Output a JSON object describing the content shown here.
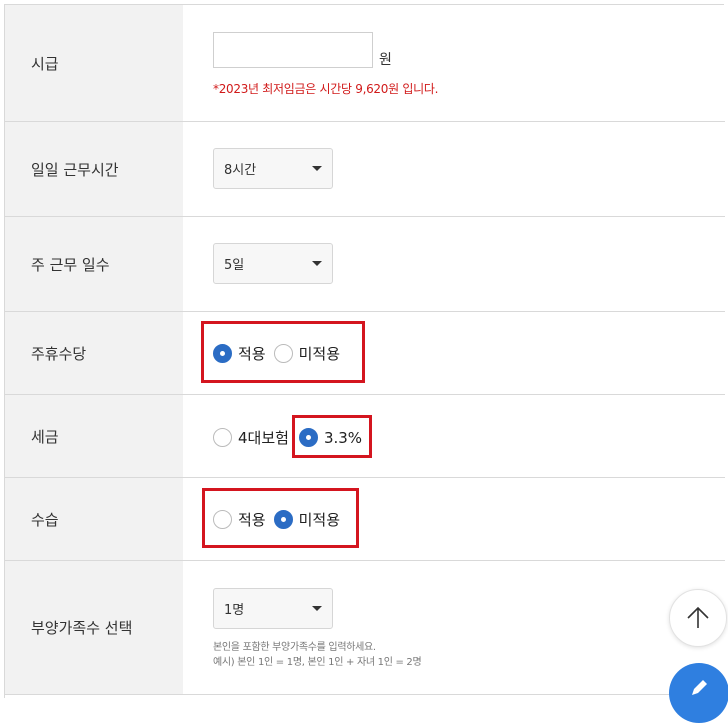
{
  "rows": [
    {
      "label": "시급"
    },
    {
      "label": "일일 근무시간"
    },
    {
      "label": "주 근무 일수"
    },
    {
      "label": "주휴수당"
    },
    {
      "label": "세금"
    },
    {
      "label": "수습"
    },
    {
      "label": "부양가족수 선택"
    }
  ],
  "wage": {
    "value": "",
    "unit": "원",
    "note": "*2023년 최저임금은 시간당 9,620원 입니다."
  },
  "daily_hours": {
    "selected": "8시간"
  },
  "weekly_days": {
    "selected": "5일"
  },
  "holiday_pay": {
    "options": [
      {
        "label": "적용",
        "checked": true
      },
      {
        "label": "미적용",
        "checked": false
      }
    ]
  },
  "tax": {
    "options": [
      {
        "label": "4대보험",
        "checked": false
      },
      {
        "label": "3.3%",
        "checked": true
      }
    ]
  },
  "probation": {
    "options": [
      {
        "label": "적용",
        "checked": false
      },
      {
        "label": "미적용",
        "checked": true
      }
    ]
  },
  "dependents": {
    "selected": "1명",
    "note_line1": "본인을 포함한 부양가족수를 입력하세요.",
    "note_line2": "예시) 본인 1인 = 1명, 본인 1인 + 자녀 1인 = 2명"
  },
  "colors": {
    "accent": "#2b6cc4",
    "highlight": "#d4151f",
    "note_red": "#d11a1a",
    "fab_blue": "#2f7fe0"
  }
}
